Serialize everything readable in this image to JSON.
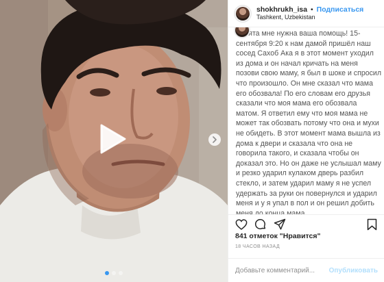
{
  "post": {
    "username": "shokhrukh_isa",
    "separator": "•",
    "follow_label": "Подписаться",
    "location": "Tashkent, Uzbekistan",
    "caption": "Ребята мне нужна ваша помощь! 15-сентября 9:20 к нам дамой пришёл наш сосед Сахоб Ака я в этот момент уходил из дома и он начал кричать на меня позови свою маму, я был в шоке и спросил что произошло. Он мне сказал что мама его обозвала! По его словам его друзья сказали что моя мама его обозвала матом. Я ответил ему что моя мама не может так обозвать потому что она и мухи не обидеть. В этот момент мама вышла из дома к двери и сказала что она не говорила такого, и сказала чтобы он доказал это. Но он даже не услышал маму и резко ударил кулаком дверь разбил стекло, и затем ударил маму я не успел удержать за руки он повернулся и ударил меня и у я упал в пол и он решил добить меня до конца мама",
    "likes_count": "841 отметок",
    "likes_suffix": "\"Нравится\"",
    "timestamp": "18 часов назад"
  },
  "media": {
    "type": "video",
    "play_icon": "play-icon",
    "next_icon": "chevron-right-icon",
    "carousel_pages": 3,
    "carousel_active": 1
  },
  "actions": {
    "like_icon": "heart-icon",
    "comment_icon": "comment-icon",
    "share_icon": "share-icon",
    "save_icon": "bookmark-icon"
  },
  "comment": {
    "placeholder": "Добавьте комментарий...",
    "publish_label": "Опубликовать"
  },
  "colors": {
    "accent": "#3897f0",
    "text": "#262626",
    "muted": "#8e8e8e",
    "publish_disabled": "#b2dffc"
  }
}
